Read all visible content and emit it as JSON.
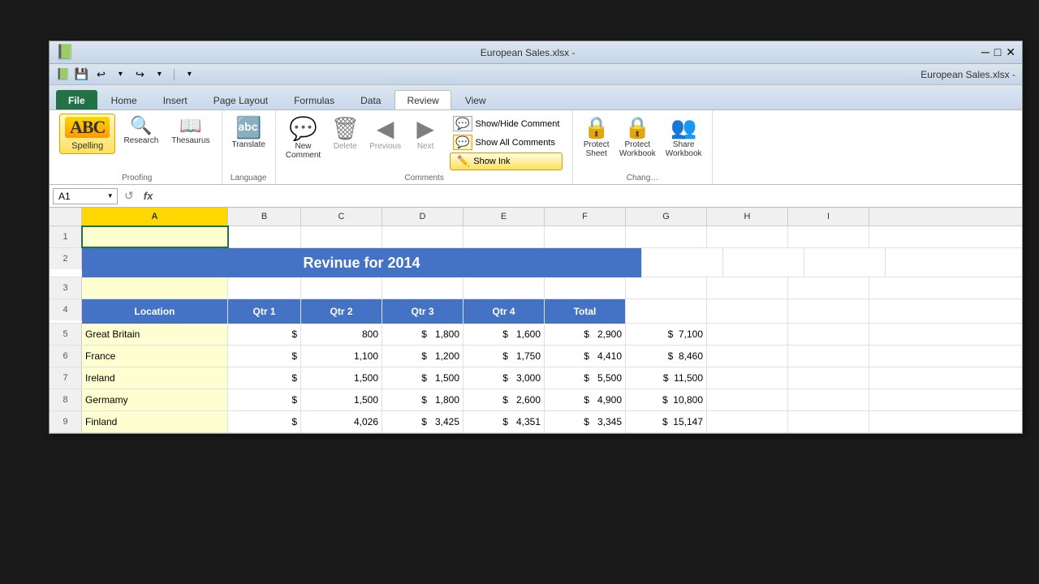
{
  "window": {
    "title": "European Sales.xlsx - ",
    "icon": "📗"
  },
  "quickaccess": {
    "save": "💾",
    "undo": "↩",
    "redo": "↪",
    "dropdown": "▾",
    "customize": "▾"
  },
  "tabs": [
    {
      "label": "File",
      "active": false
    },
    {
      "label": "Home",
      "active": false
    },
    {
      "label": "Insert",
      "active": false
    },
    {
      "label": "Page Layout",
      "active": false
    },
    {
      "label": "Formulas",
      "active": false
    },
    {
      "label": "Data",
      "active": false
    },
    {
      "label": "Review",
      "active": true
    },
    {
      "label": "View",
      "active": false
    }
  ],
  "ribbon": {
    "groups": {
      "proofing": {
        "label": "Proofing",
        "spelling": {
          "label": "Spelling",
          "icon": "ABC"
        },
        "research": {
          "label": "Research",
          "icon": "🔍"
        },
        "thesaurus": {
          "label": "Thesaurus",
          "icon": "📖"
        }
      },
      "language": {
        "label": "Language",
        "translate": {
          "label": "Translate",
          "icon": "🔤"
        }
      },
      "comments": {
        "label": "Comments",
        "new_comment": {
          "label": "New\nComment",
          "icon": "💬"
        },
        "delete": {
          "label": "Delete",
          "icon": "🗑"
        },
        "previous": {
          "label": "Previous",
          "icon": "◀"
        },
        "next": {
          "label": "Next",
          "icon": "▶"
        },
        "show_hide": "Show/Hide Comment",
        "show_all": "Show All Comments",
        "show_ink": "Show Ink"
      },
      "changes": {
        "label": "Chang",
        "protect_sheet": {
          "label": "Protect\nSheet",
          "icon": "🔒"
        },
        "protect_workbook": {
          "label": "Protect\nWorkbook",
          "icon": "🔒"
        },
        "share_workbook": {
          "label": "Share\nWorkbook",
          "icon": "👥"
        }
      }
    }
  },
  "formulabar": {
    "cellref": "A1",
    "dropdown": "▾",
    "cancel_icon": "↺",
    "fx_icon": "fx"
  },
  "spreadsheet": {
    "columns": [
      "A",
      "B",
      "C",
      "D",
      "E",
      "F",
      "G",
      "H",
      "I"
    ],
    "selected_col": "A",
    "active_cell": "A1",
    "rows": [
      {
        "num": 1,
        "cells": [
          "",
          "",
          "",
          "",
          "",
          "",
          "",
          "",
          ""
        ]
      },
      {
        "num": 2,
        "cells": [
          "Revinue for 2014",
          "",
          "",
          "",
          "",
          "",
          "",
          "",
          ""
        ],
        "merged": true,
        "style": "title"
      },
      {
        "num": 3,
        "cells": [
          "",
          "",
          "",
          "",
          "",
          "",
          "",
          "",
          ""
        ]
      },
      {
        "num": 4,
        "cells": [
          "Location",
          "Qtr 1",
          "Qtr 2",
          "Qtr 3",
          "Qtr 4",
          "Total",
          "",
          "",
          ""
        ],
        "style": "header"
      },
      {
        "num": 5,
        "cells": [
          "Great Britain",
          "$",
          "800",
          "$",
          "1,800",
          "$",
          "1,600",
          "$",
          "2,900"
        ],
        "extra": "$ 7,100"
      },
      {
        "num": 6,
        "cells": [
          "France",
          "$",
          "1,100",
          "$",
          "1,200",
          "$",
          "1,750",
          "$",
          "4,410"
        ],
        "extra": "$ 8,460"
      },
      {
        "num": 7,
        "cells": [
          "Ireland",
          "$",
          "1,500",
          "$",
          "1,500",
          "$",
          "3,000",
          "$",
          "5,500"
        ],
        "extra": "$ 11,500"
      },
      {
        "num": 8,
        "cells": [
          "Germamy",
          "$",
          "1,500",
          "$",
          "1,800",
          "$",
          "2,600",
          "$",
          "4,900"
        ],
        "extra": "$ 10,800"
      },
      {
        "num": 9,
        "cells": [
          "Finland",
          "$",
          "4,026",
          "$",
          "3,425",
          "$",
          "4,351",
          "$",
          "3,345"
        ],
        "extra": "$ 15,147"
      }
    ]
  }
}
